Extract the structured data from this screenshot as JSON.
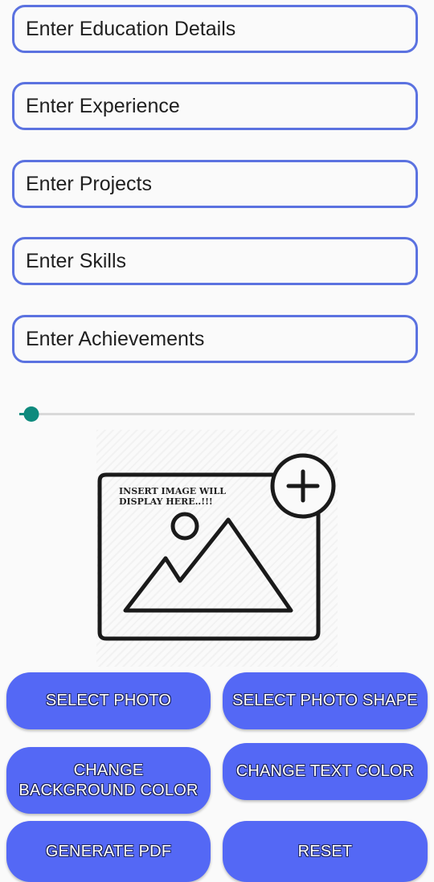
{
  "form": {
    "fields": [
      {
        "placeholder": "Enter Education Details"
      },
      {
        "placeholder": "Enter Experience"
      },
      {
        "placeholder": "Enter Projects"
      },
      {
        "placeholder": "Enter Skills"
      },
      {
        "placeholder": "Enter Achievements"
      }
    ],
    "size_slider": {
      "value_fraction": 0.03
    }
  },
  "image_preview": {
    "caption_line1": "INSERT IMAGE WILL",
    "caption_line2": "DISPLAY HERE..!!!",
    "icon": "add-image-icon"
  },
  "buttons": {
    "select_photo": "SELECT PHOTO",
    "select_photo_shape": "SELECT PHOTO SHAPE",
    "change_background_line1": "CHANGE",
    "change_background_line2": "BACKGROUND COLOR",
    "change_text_color": "CHANGE TEXT COLOR",
    "generate_pdf": "GENERATE PDF",
    "reset": "RESET"
  },
  "colors": {
    "field_border": "#5b72e0",
    "button_bg": "#5468f5",
    "slider_accent": "#0e8a7d"
  }
}
